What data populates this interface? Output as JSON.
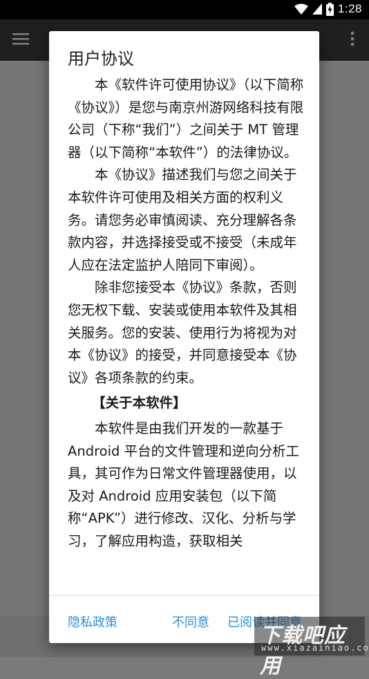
{
  "status_bar": {
    "time": "1:28"
  },
  "dialog": {
    "title": "用户协议",
    "paragraphs": [
      "本《软件许可使用协议》（以下简称《协议》）是您与南京州游网络科技有限公司（下称“我们”）之间关于 MT 管理器（以下简称“本软件”）的法律协议。",
      "本《协议》描述我们与您之间关于本软件许可使用及相关方面的权利义务。请您务必审慎阅读、充分理解各条款内容，并选择接受或不接受（未成年人应在法定监护人陪同下审阅）。",
      "除非您接受本《协议》条款，否则您无权下载、安装或使用本软件及其相关服务。您的安装、使用行为将视为对本《协议》的接受，并同意接受本《协议》各项条款的约束。"
    ],
    "section_heading": "【关于本软件】",
    "section_paragraph": "本软件是由我们开发的一款基于Android 平台的文件管理和逆向分析工具，其可作为日常文件管理器使用，以及对 Android 应用安装包（以下简称“APK”）进行修改、汉化、分析与学习，了解应用构造，获取相关",
    "buttons": {
      "privacy": "隐私政策",
      "disagree": "不同意",
      "agree": "已阅读并同意"
    }
  },
  "watermark": {
    "text": "下载吧应用",
    "url": "www.xiazainiao.com"
  },
  "icons": {
    "menu": "hamburger-menu-icon",
    "more": "more-vert-icon",
    "wifi": "wifi-icon",
    "signal": "signal-icon",
    "battery": "battery-charging-icon"
  }
}
